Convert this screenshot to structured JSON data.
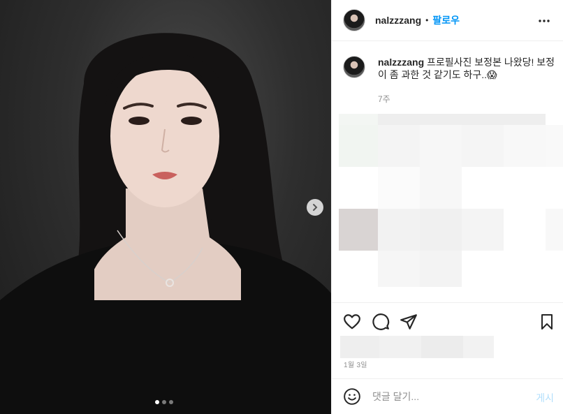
{
  "post": {
    "username": "nalzzzang",
    "separator": "•",
    "follow_label": "팔로우",
    "more_icon": "more-horizontal-icon",
    "caption_username": "nalzzzang",
    "caption_text": " 프로필사진 보정본 나왔당! 보정이 좀 과한 것 같기도 하구..😱",
    "time_ago": "7주",
    "post_date": "1월 3일"
  },
  "carousel": {
    "next_icon": "chevron-right-icon",
    "slide_count": 3,
    "active_index": 0
  },
  "actions": {
    "like_icon": "heart-icon",
    "comment_icon": "comment-icon",
    "share_icon": "send-icon",
    "save_icon": "bookmark-icon"
  },
  "comment": {
    "emoji_icon": "emoji-icon",
    "placeholder": "댓글 달기...",
    "post_label": "게시"
  },
  "colors": {
    "accent": "#0095f6",
    "post_disabled": "#b2dffc",
    "muted": "#8e8e8e",
    "divider": "#efefef"
  }
}
